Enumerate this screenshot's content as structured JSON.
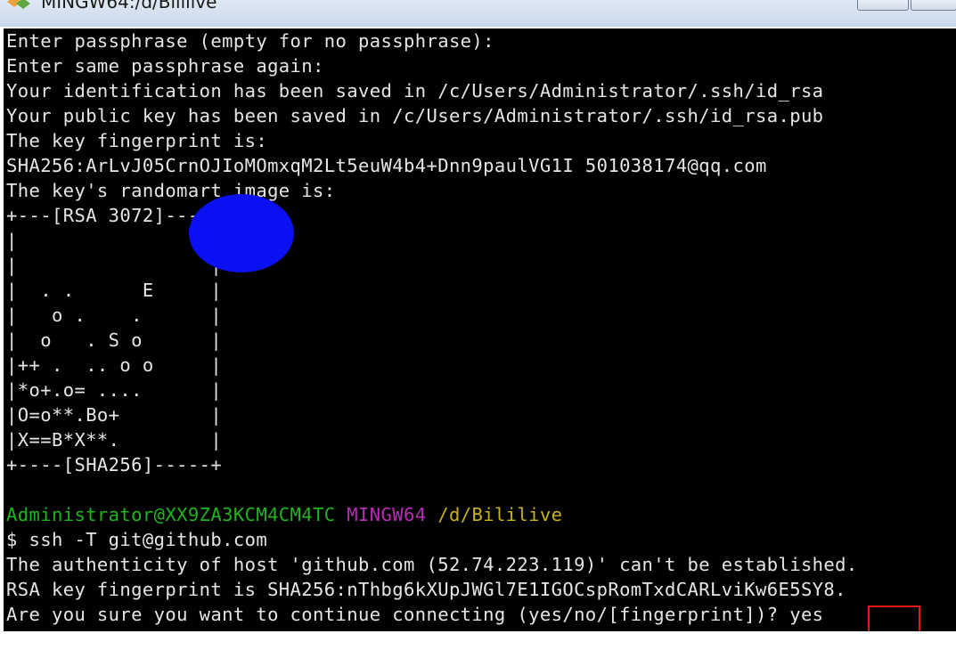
{
  "window": {
    "title": "MINGW64:/d/Bililive",
    "icon": "git-bash-icon"
  },
  "terminal": {
    "lines": [
      "Enter passphrase (empty for no passphrase):",
      "Enter same passphrase again:",
      "Your identification has been saved in /c/Users/Administrator/.ssh/id_rsa",
      "Your public key has been saved in /c/Users/Administrator/.ssh/id_rsa.pub",
      "The key fingerprint is:",
      "SHA256:ArLvJ05CrnOJIoMOmxqM2Lt5euW4b4+Dnn9paulVG1I 501038174@qq.com",
      "The key's randomart image is:",
      "+---[RSA 3072]----+",
      "|                 |",
      "|                 |",
      "|  . .      E     |",
      "|   o .    .      |",
      "|  o   . S o      |",
      "|++ .  .. o o     |",
      "|*o+.o= ....      |",
      "|O=o**.Bo+        |",
      "|X==B*X**.        |",
      "+----[SHA256]-----+",
      ""
    ],
    "prompt": {
      "user_host": "Administrator@XX9ZA3KCM4CM4TC",
      "system": "MINGW64",
      "path": "/d/Bililive"
    },
    "after_prompt": [
      "$ ssh -T git@github.com",
      "The authenticity of host 'github.com (52.74.223.119)' can't be established.",
      "RSA key fingerprint is SHA256:nThbg6kXUpJWGl7E1IGOCspRomTxdCARLviKw6E5SY8.",
      "Are you sure you want to continue connecting (yes/no/[fingerprint])? yes"
    ],
    "colors": {
      "background": "#000000",
      "text": "#e6e6e6",
      "user_host": "#1fb51f",
      "system": "#b62db6",
      "path": "#c8b21c",
      "highlight": "#e01a1a",
      "cursor_dot": "#0b10f2"
    }
  }
}
